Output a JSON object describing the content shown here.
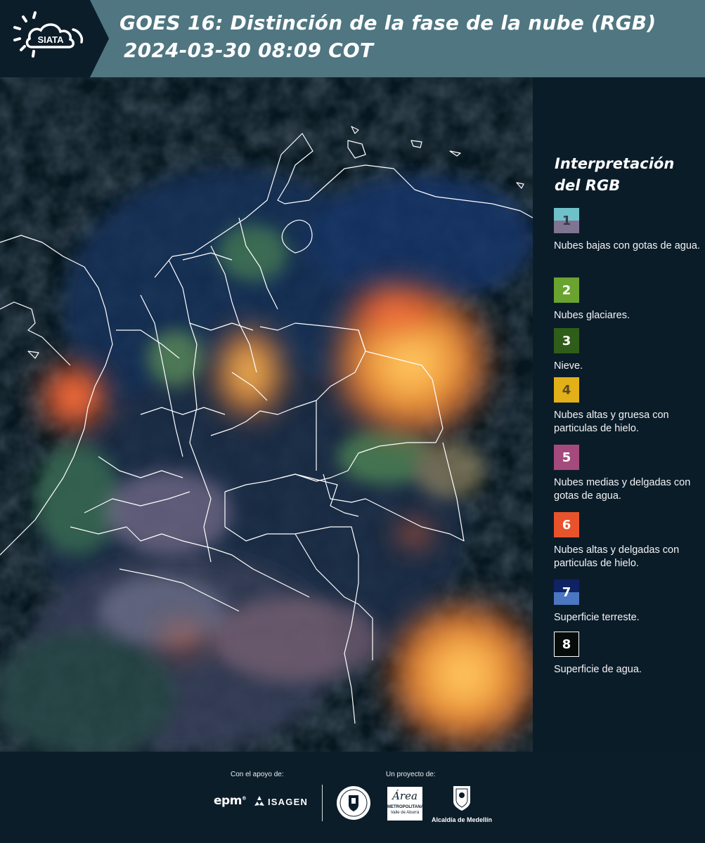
{
  "header": {
    "logo_text": "SIATA",
    "title_line1": "GOES 16: Distinción de la fase de la nube (RGB)",
    "title_line2": "2024-03-30 08:09 COT"
  },
  "legend": {
    "title_line1": "Interpretación",
    "title_line2": "del RGB",
    "items": [
      {
        "number": "1",
        "label": "Nubes bajas con gotas de agua.",
        "color_top": "#6fc1c9",
        "color_bottom": "#7f7491",
        "text_color": "#3a3a48"
      },
      {
        "number": "2",
        "label": "Nubes glaciares.",
        "color_top": "#6aa32f",
        "color_bottom": "#6aa32f",
        "text_color": "#ffffff"
      },
      {
        "number": "3",
        "label": "Nieve.",
        "color_top": "#2f5d1a",
        "color_bottom": "#2f5d1a",
        "text_color": "#ffffff"
      },
      {
        "number": "4",
        "label": "Nubes altas y gruesa con particulas de hielo.",
        "color_top": "#e2b018",
        "color_bottom": "#e2b018",
        "text_color": "#5a4a22"
      },
      {
        "number": "5",
        "label": "Nubes medias y delgadas con gotas de agua.",
        "color_top": "#a54a7d",
        "color_bottom": "#a54a7d",
        "text_color": "#ffffff"
      },
      {
        "number": "6",
        "label": "Nubes altas y delgadas con particulas de hielo.",
        "color_top": "#e8532c",
        "color_bottom": "#e8532c",
        "text_color": "#ffffff"
      },
      {
        "number": "7",
        "label": "Superficie terreste.",
        "color_top": "#0f2263",
        "color_bottom": "#4a76c2",
        "text_color": "#ffffff"
      },
      {
        "number": "8",
        "label": "Superficie de agua.",
        "color_top": "#050c0a",
        "color_bottom": "#050c0a",
        "text_color": "#ffffff"
      }
    ]
  },
  "footer": {
    "support_caption": "Con el apoyo de:",
    "project_caption": "Un proyecto de:",
    "sponsor_epm": "epm",
    "sponsor_isagen": "ISAGEN",
    "sponsor_area_line1": "METROPOLITANA",
    "sponsor_area_line2": "Valle de Aburrá",
    "sponsor_area_script": "Área",
    "sponsor_alcaldia": "Alcaldía de Medellín"
  },
  "colors": {
    "header_bg": "#4f7681",
    "logo_bg": "#0c1d2a",
    "panel_bg": "#0b1c29",
    "cloud_orange": "#f59a3a",
    "land_blue": "#15305a",
    "border_white": "#ffffff"
  }
}
